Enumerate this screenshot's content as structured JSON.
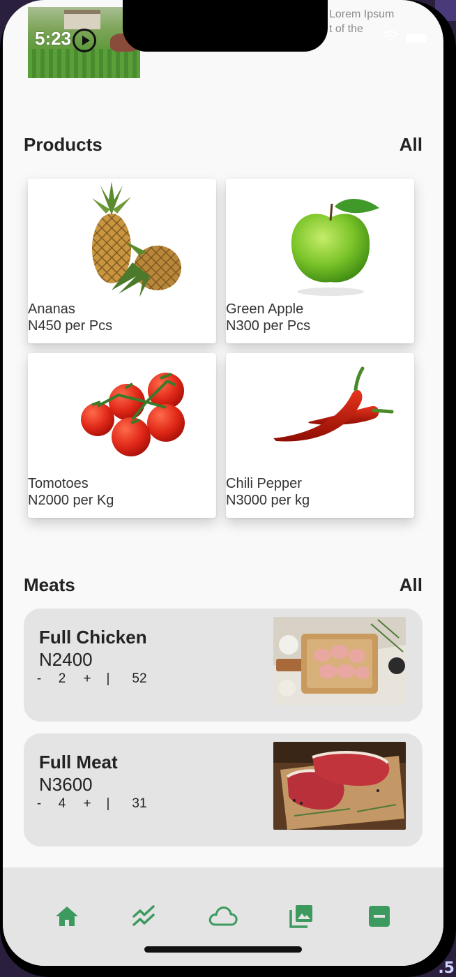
{
  "status": {
    "time": "5:23",
    "notification_line1": "Lorem Ipsum",
    "notification_line2": "t of the"
  },
  "products": {
    "title": "Products",
    "all_label": "All",
    "items": [
      {
        "name": "Ananas",
        "price": "N450 per Pcs",
        "icon": "pineapple-image"
      },
      {
        "name": "Green Apple",
        "price": "N300 per Pcs",
        "icon": "green-apple-image"
      },
      {
        "name": "Tomotoes",
        "price": "N2000 per Kg",
        "icon": "tomatoes-image"
      },
      {
        "name": "Chili Pepper",
        "price": "N3000 per kg",
        "icon": "chili-pepper-image"
      }
    ]
  },
  "meats": {
    "title": "Meats",
    "all_label": "All",
    "items": [
      {
        "name": "Full Chicken",
        "price": "N2400",
        "minus": "-",
        "quantity": "2",
        "plus": "+",
        "separator": "|",
        "stock": "52"
      },
      {
        "name": "Full Meat",
        "price": "N3600",
        "minus": "-",
        "quantity": "4",
        "plus": "+",
        "separator": "|",
        "stock": "31"
      }
    ]
  },
  "tabbar": {
    "accent_color": "#3c9a5f",
    "tabs": [
      "home-icon",
      "trending-icon",
      "cloud-icon",
      "gallery-icon",
      "minus-box-icon"
    ]
  },
  "corner_text": ".5"
}
